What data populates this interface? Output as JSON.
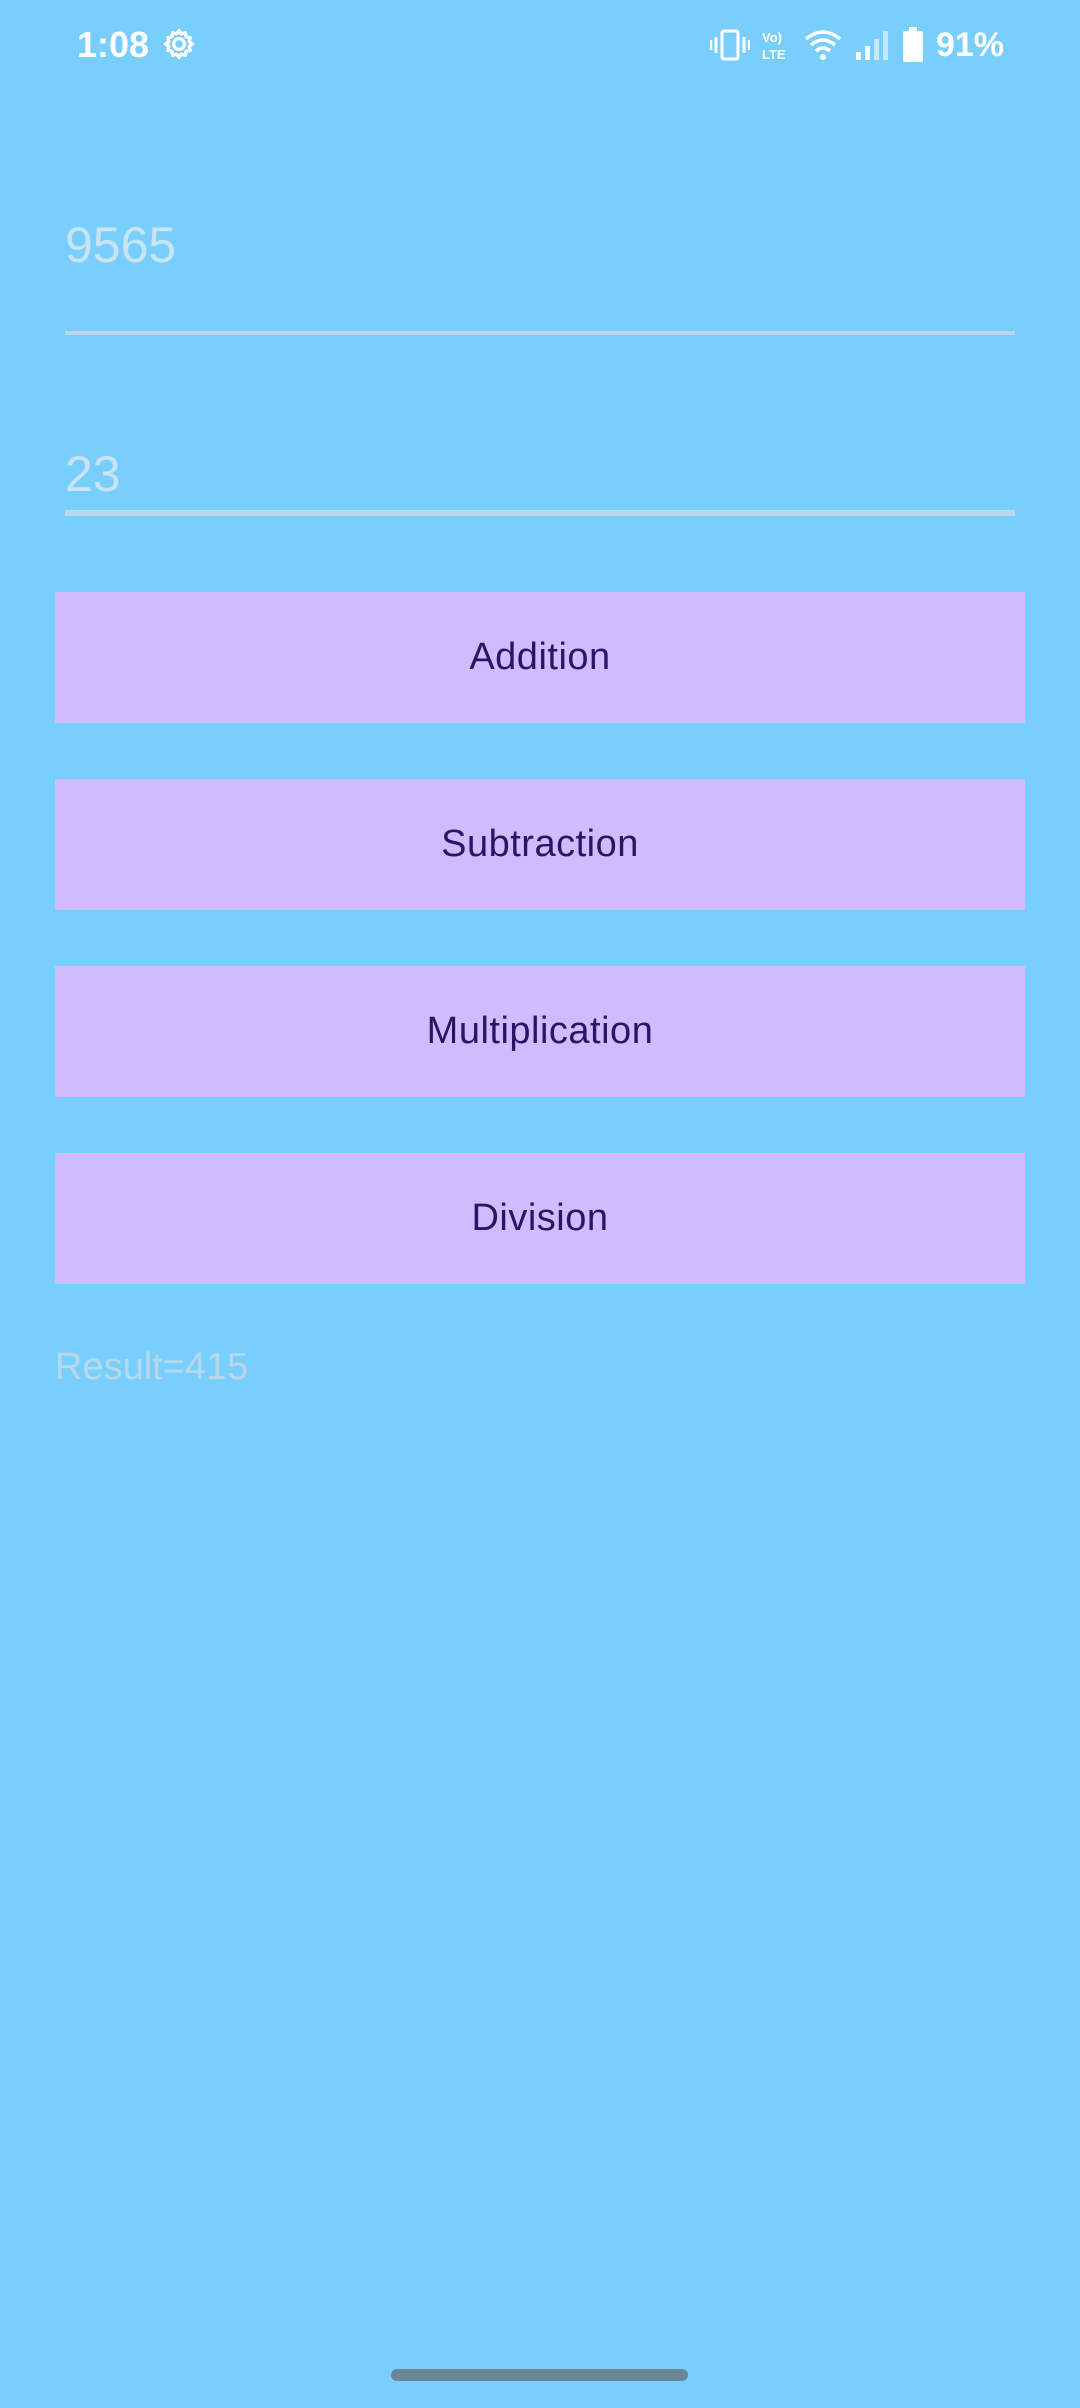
{
  "status_bar": {
    "time": "1:08",
    "battery_percent": "91%",
    "icons": [
      "settings-icon",
      "vibrate-icon",
      "volte-icon",
      "wifi-icon",
      "signal-icon",
      "battery-icon"
    ]
  },
  "calculator": {
    "first_number": "9565",
    "second_number": "23",
    "buttons": {
      "addition": "Addition",
      "subtraction": "Subtraction",
      "multiplication": "Multiplication",
      "division": "Division"
    },
    "result": "Result=415"
  },
  "colors": {
    "background": "#78cffd",
    "button_fill": "#d1bbff",
    "button_text": "#2b1468",
    "input_text": "#c8e4f3"
  }
}
